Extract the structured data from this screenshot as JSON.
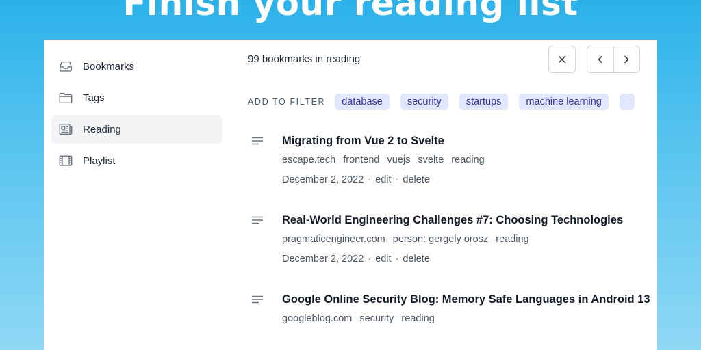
{
  "headline": "Finish your reading list",
  "sidebar": {
    "items": [
      {
        "label": "Bookmarks",
        "icon": "inbox-icon"
      },
      {
        "label": "Tags",
        "icon": "folder-icon"
      },
      {
        "label": "Reading",
        "icon": "newspaper-icon",
        "active": true
      },
      {
        "label": "Playlist",
        "icon": "film-icon"
      }
    ]
  },
  "main": {
    "count_text": "99 bookmarks in reading",
    "filter_label": "ADD TO FILTER",
    "filters": [
      "database",
      "security",
      "startups",
      "machine learning"
    ],
    "bookmarks": [
      {
        "title": "Migrating from Vue 2 to Svelte",
        "domain": "escape.tech",
        "tags": [
          "frontend",
          "vuejs",
          "svelte",
          "reading"
        ],
        "date": "December 2, 2022",
        "edit": "edit",
        "delete": "delete"
      },
      {
        "title": "Real-World Engineering Challenges #7: Choosing Technologies",
        "domain": "pragmaticengineer.com",
        "tags": [
          "person: gergely orosz",
          "reading"
        ],
        "date": "December 2, 2022",
        "edit": "edit",
        "delete": "delete"
      },
      {
        "title": "Google Online Security Blog: Memory Safe Languages in Android 13",
        "domain": "googleblog.com",
        "tags": [
          "security",
          "reading"
        ]
      }
    ]
  },
  "colors": {
    "chip_bg": "#e0e7ff",
    "chip_text": "#3730a3",
    "active_nav_bg": "#f3f4f6"
  }
}
